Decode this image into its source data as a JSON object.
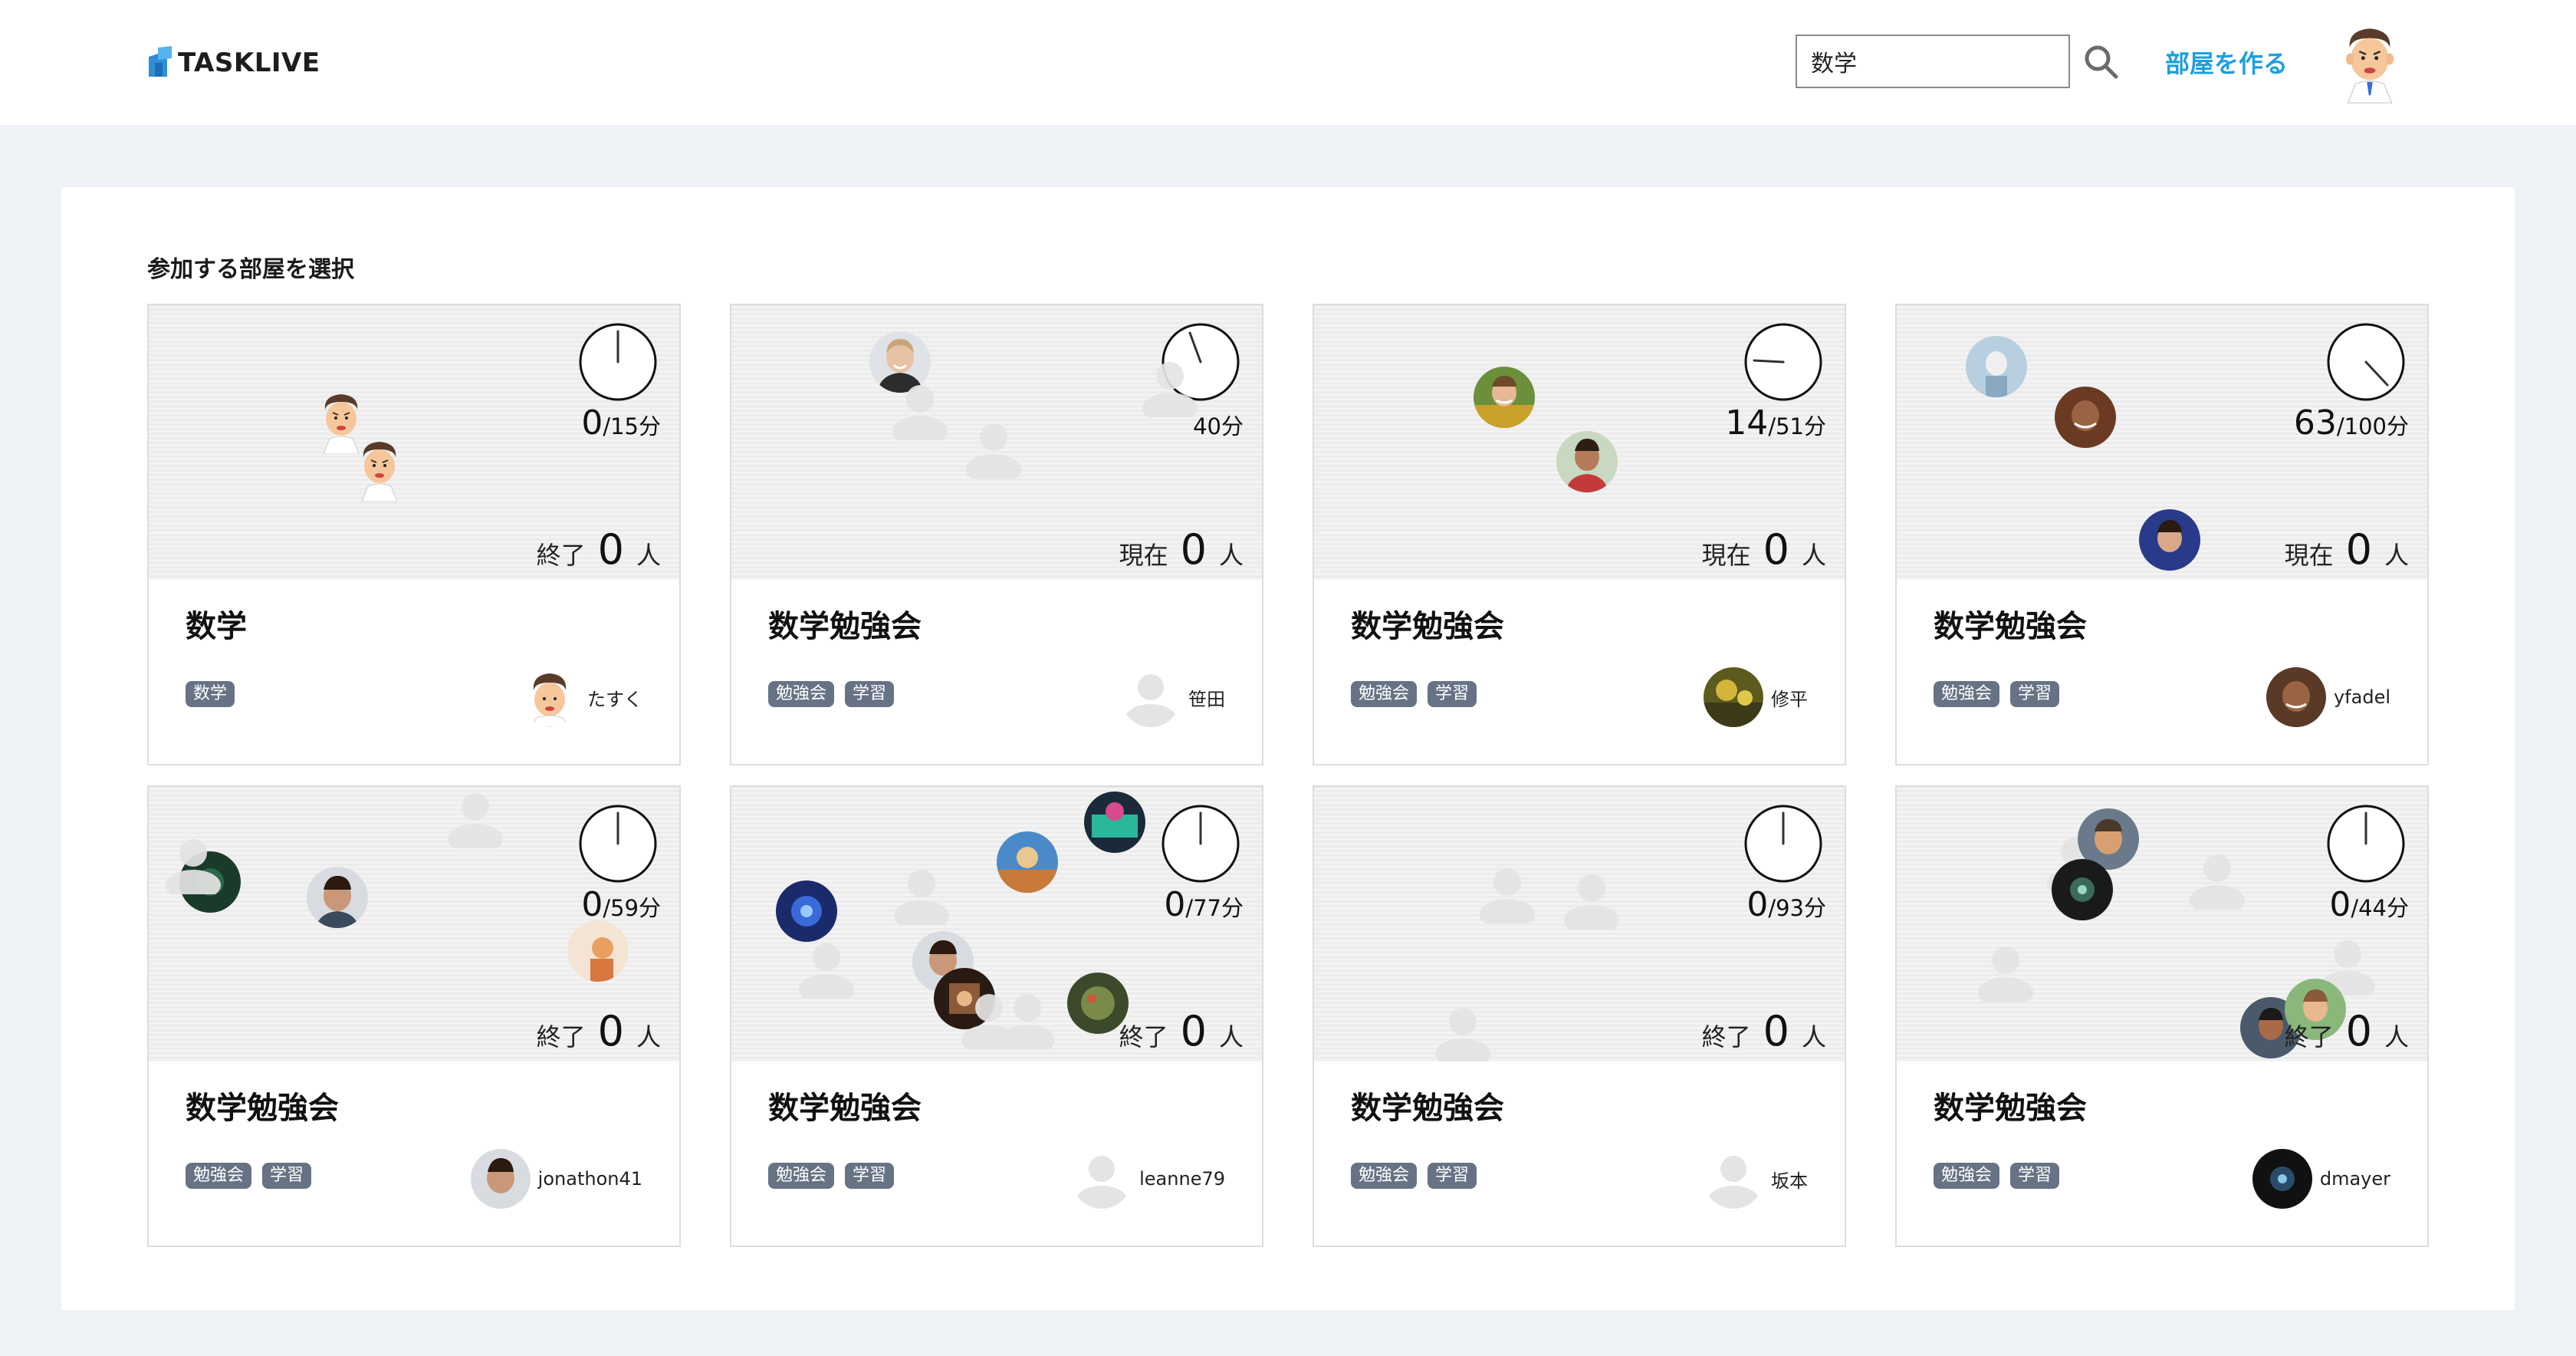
{
  "header": {
    "logo_text": "TASKLIVE",
    "search": {
      "value": "数学",
      "placeholder": ""
    },
    "create_room_label": "部屋を作る"
  },
  "panel": {
    "title": "参加する部屋を選択"
  },
  "rooms": [
    {
      "name": "数学",
      "tags": [
        "数学"
      ],
      "owner": "たすく",
      "elapsed": "0",
      "total": "/15分",
      "status": "終了",
      "count": "0",
      "unit": "人"
    },
    {
      "name": "数学勉強会",
      "tags": [
        "勉強会",
        "学習"
      ],
      "owner": "笹田",
      "elapsed": "",
      "total": "40分",
      "status": "現在",
      "count": "0",
      "unit": "人"
    },
    {
      "name": "数学勉強会",
      "tags": [
        "勉強会",
        "学習"
      ],
      "owner": "修平",
      "elapsed": "14",
      "total": "/51分",
      "status": "現在",
      "count": "0",
      "unit": "人"
    },
    {
      "name": "数学勉強会",
      "tags": [
        "勉強会",
        "学習"
      ],
      "owner": "yfadel",
      "elapsed": "63",
      "total": "/100分",
      "status": "現在",
      "count": "0",
      "unit": "人"
    },
    {
      "name": "数学勉強会",
      "tags": [
        "勉強会",
        "学習"
      ],
      "owner": "jonathon41",
      "elapsed": "0",
      "total": "/59分",
      "status": "終了",
      "count": "0",
      "unit": "人"
    },
    {
      "name": "数学勉強会",
      "tags": [
        "勉強会",
        "学習"
      ],
      "owner": "leanne79",
      "elapsed": "0",
      "total": "/77分",
      "status": "終了",
      "count": "0",
      "unit": "人"
    },
    {
      "name": "数学勉強会",
      "tags": [
        "勉強会",
        "学習"
      ],
      "owner": "坂本",
      "elapsed": "0",
      "total": "/93分",
      "status": "終了",
      "count": "0",
      "unit": "人"
    },
    {
      "name": "数学勉強会",
      "tags": [
        "勉強会",
        "学習"
      ],
      "owner": "dmayer",
      "elapsed": "0",
      "total": "/44分",
      "status": "終了",
      "count": "0",
      "unit": "人"
    }
  ],
  "icons": {
    "logo": "tasklive-logo-icon",
    "search": "search-icon",
    "clock": "clock-icon",
    "avatar_default": "default-avatar-icon"
  },
  "colors": {
    "accent": "#1e9fe0",
    "tag_bg": "#677385",
    "page_bg": "#eef2f7"
  }
}
